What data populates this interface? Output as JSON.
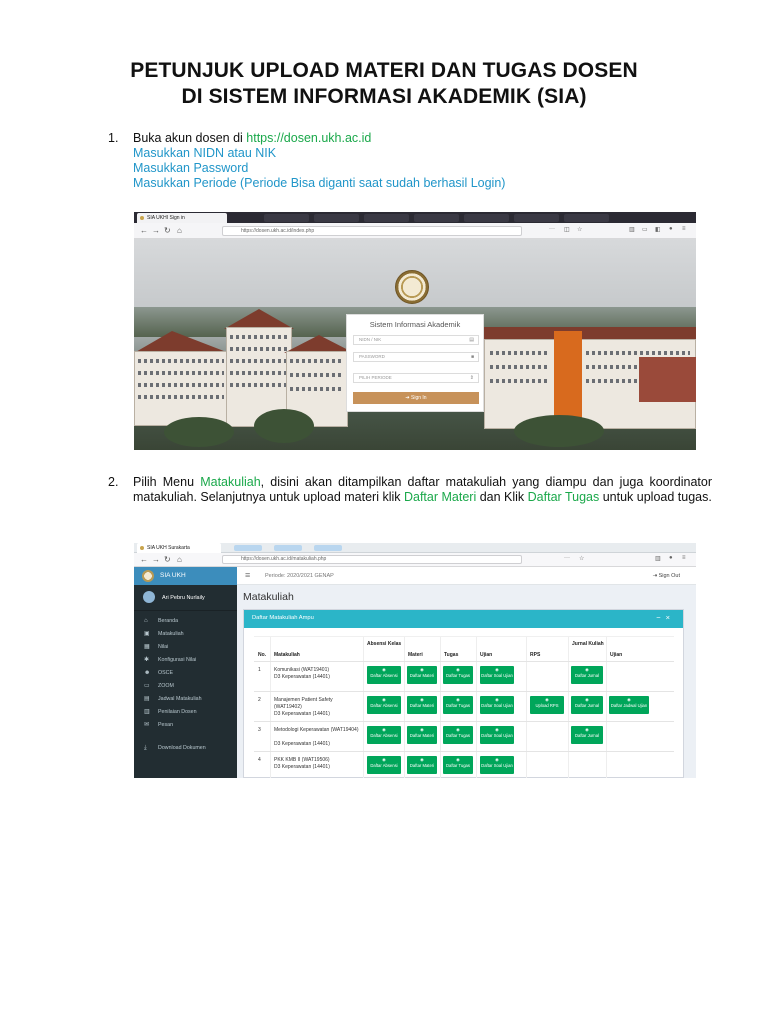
{
  "title": {
    "line1": "PETUNJUK UPLOAD MATERI DAN TUGAS  DOSEN",
    "line2": "DI SISTEM INFORMASI AKADEMIK (SIA)"
  },
  "step1": {
    "number": "1.",
    "text_prefix": "Buka akun dosen di ",
    "url": "https://dosen.ukh.ac.id",
    "line2": "Masukkan NIDN atau NIK",
    "line3": "Masukkan Password",
    "line4": "Masukkan Periode (Periode Bisa diganti saat sudah berhasil Login)"
  },
  "step2": {
    "number": "2.",
    "t1": "Pilih Menu ",
    "matakuliah": "Matakuliah",
    "t2": ", disini akan ditampilkan daftar matakuliah yang diampu  dan juga koordinator matakuliah. Selanjutnya untuk upload materi klik ",
    "daftar_materi": "Daftar Materi",
    "t3": " dan Klik ",
    "daftar_tugas": "Daftar Tugas",
    "t4": " untuk upload tugas."
  },
  "screenshot1": {
    "tab_title": "SIA UKHI Sign in",
    "url": "https://dosen.ukh.ac.id/index.php",
    "login_title": "Sistem Informasi Akademik",
    "nidn_placeholder": "NIDN / NIK",
    "password_placeholder": "PASSWORD",
    "periode_placeholder": "PILIH PERIODE",
    "signin_label": "Sign In"
  },
  "screenshot2": {
    "tab_title": "SIA UKH Surakarta",
    "url": "https://dosen.ukh.ac.id/matakuliah.php",
    "brand": "SIA UKH",
    "user_name": "Ari Pebru Nurlaily",
    "periode": "Periode: 2020/2021 GENAP",
    "sign_out": "Sign Out",
    "page_header": "Matakuliah",
    "box_title": "Daftar Matakuliah Ampu",
    "menu": [
      "Beranda",
      "Matakuliah",
      "Nilai",
      "Konfigurasi Nilai",
      "OSCE",
      "ZOOM",
      "Jadwal Matakuliah",
      "Penilaian Dosen",
      "Pesan",
      "Download Dokumen"
    ],
    "menu_icons": [
      "home-icon",
      "book-icon",
      "grade-icon",
      "gear-icon",
      "user-icon",
      "video-icon",
      "calendar-icon",
      "clipboard-icon",
      "mail-icon",
      "download-icon"
    ],
    "table_headers": [
      "No.",
      "Matakuliah",
      "Absensi Kelas",
      "Materi",
      "Tugas",
      "Ujian",
      "RPS",
      "Jurnal Kuliah",
      "Ujian"
    ],
    "rows": [
      {
        "no": "1",
        "name": "Komunikasi (WAT19401)",
        "prog": "D3 Keperawatan (14401)"
      },
      {
        "no": "2",
        "name": "Manajemen Patient Safety (WAT19402)",
        "prog": "D3 Keperawatan (14401)"
      },
      {
        "no": "3",
        "name": "Metodologi Keperawatan (WAT19404)",
        "prog": "D3 Keperawatan (14401)"
      },
      {
        "no": "4",
        "name": "PKK KMB II (WAT19506)",
        "prog": "D3 Keperawatan (14401)"
      }
    ],
    "btn_absensi": "Daftar Absensi",
    "btn_materi": "Daftar Materi",
    "btn_tugas": "Daftar Tugas",
    "btn_ujian": "Daftar Soal Ujian",
    "btn_rps": "Upload RPS",
    "btn_jurnal": "Daftar Jurnal",
    "btn_jadwal_ujian": "Daftar Jadwal Ujian"
  }
}
